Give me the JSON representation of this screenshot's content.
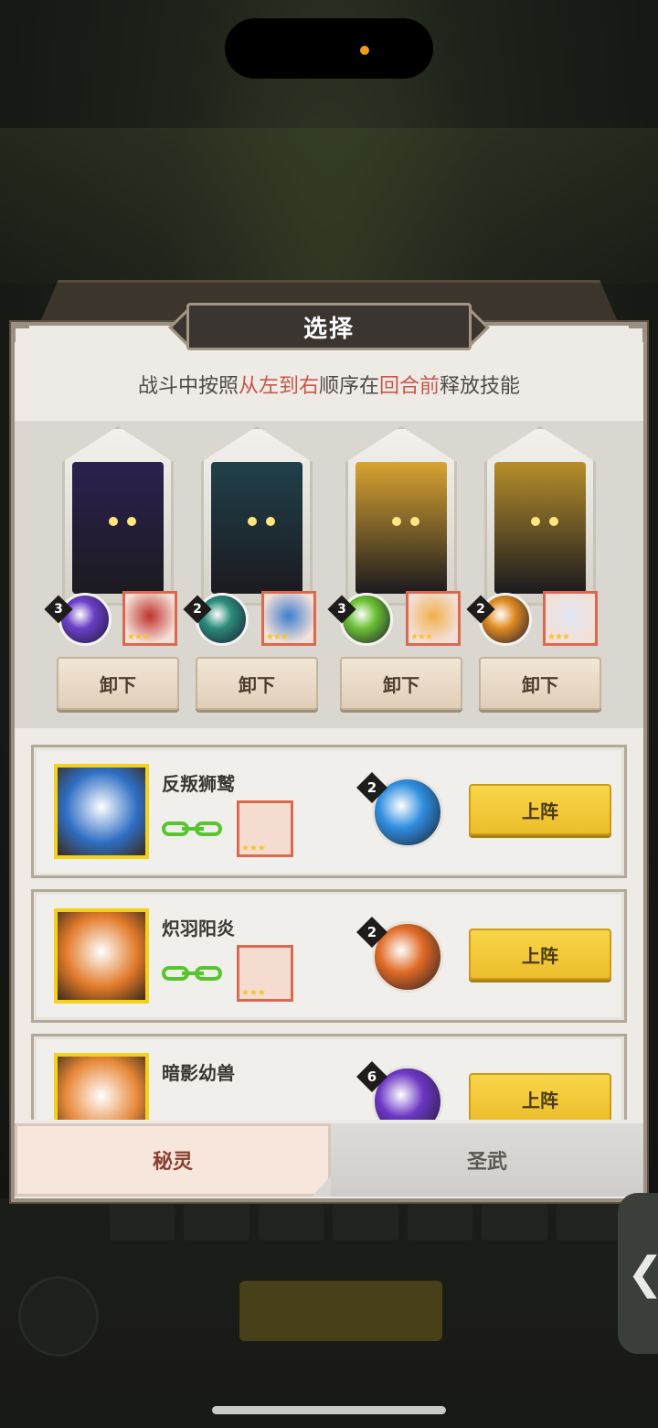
{
  "dialog": {
    "title": "选择",
    "subtitle_parts": [
      "战斗中按照",
      "从左到右",
      "顺序在",
      "回合前",
      "释放技能"
    ]
  },
  "slots": [
    {
      "level": "3",
      "unload_label": "卸下",
      "card_color": "#2b2150",
      "orb_color": "#6a3fc8",
      "mini_color": "#c0332d"
    },
    {
      "level": "2",
      "unload_label": "卸下",
      "card_color": "#20404a",
      "orb_color": "#2a8c7a",
      "mini_color": "#3f7ed0"
    },
    {
      "level": "3",
      "unload_label": "卸下",
      "card_color": "#d9a431",
      "orb_color": "#6cc234",
      "mini_color": "#f0b04d"
    },
    {
      "level": "2",
      "unload_label": "卸下",
      "card_color": "#b68e2a",
      "orb_color": "#e08c22",
      "mini_color": "#dfe7f2"
    }
  ],
  "candidates": [
    {
      "name": "反叛狮鹫",
      "level": "2",
      "deploy_label": "上阵",
      "portrait_color": "#2e6ec4",
      "orb_color": "#2f8ee0"
    },
    {
      "name": "炽羽阳炎",
      "level": "2",
      "deploy_label": "上阵",
      "portrait_color": "#e27a2a",
      "orb_color": "#e06a25"
    },
    {
      "name": "暗影幼兽",
      "level": "6",
      "deploy_label": "上阵",
      "portrait_color": "#e8893a",
      "orb_color": "#6b36c4"
    }
  ],
  "tabs": {
    "active": "秘灵",
    "inactive": "圣武"
  },
  "side_tab_glyph": "❮",
  "colors": {
    "accent_red": "#c5574a",
    "button_gold": "#f4cd3c",
    "chain_green": "#57c52e"
  }
}
